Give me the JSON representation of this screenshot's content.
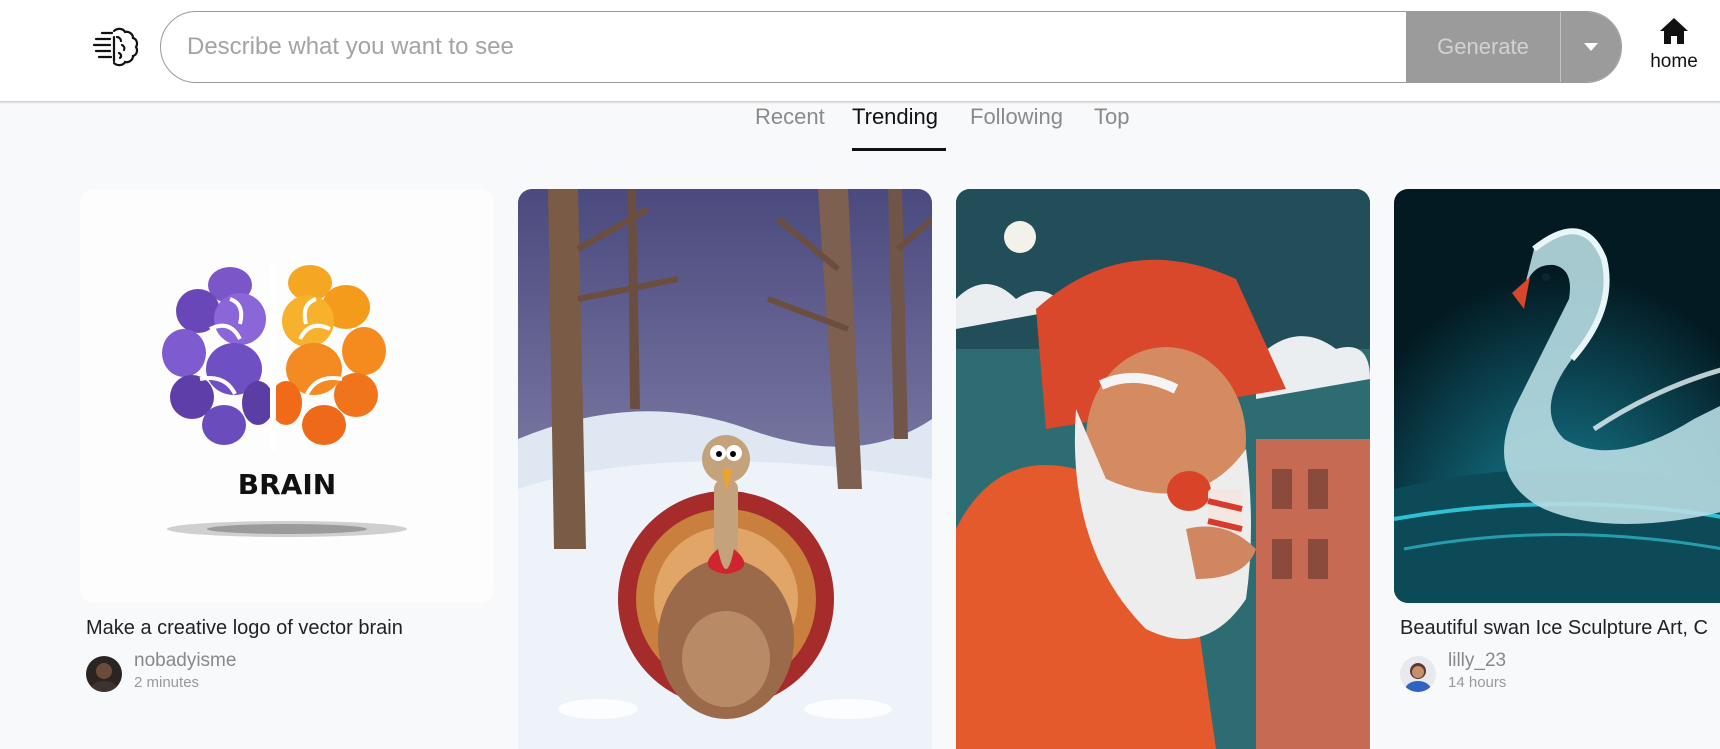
{
  "header": {
    "logo_icon": "brain-speed-icon",
    "search_placeholder": "Describe what you want to see",
    "search_value": "",
    "generate_label": "Generate",
    "dropdown_icon": "caret-down-icon",
    "home_icon": "home-icon",
    "home_label": "home"
  },
  "tabs": [
    {
      "label": "Recent",
      "active": false
    },
    {
      "label": "Trending",
      "active": true
    },
    {
      "label": "Following",
      "active": false
    },
    {
      "label": "Top",
      "active": false
    }
  ],
  "cards": [
    {
      "image": "brain-logo",
      "image_text": "BRAIN",
      "caption": "Make a creative logo of vector brain",
      "author": "nobadyisme",
      "time": "2 minutes"
    },
    {
      "image": "turkey-in-snowy-forest",
      "caption": "",
      "author": "",
      "time": ""
    },
    {
      "image": "santa-with-candy-cane-cup",
      "caption": "",
      "author": "",
      "time": ""
    },
    {
      "image": "ice-swan-sculpture",
      "caption": "Beautiful swan Ice Sculpture Art, C",
      "author": "lilly_23",
      "time": "14 hours"
    }
  ],
  "colors": {
    "generate_bg": "#9b9b9b",
    "active_tab": "#111111",
    "inactive_tab": "#8a8a8a"
  }
}
